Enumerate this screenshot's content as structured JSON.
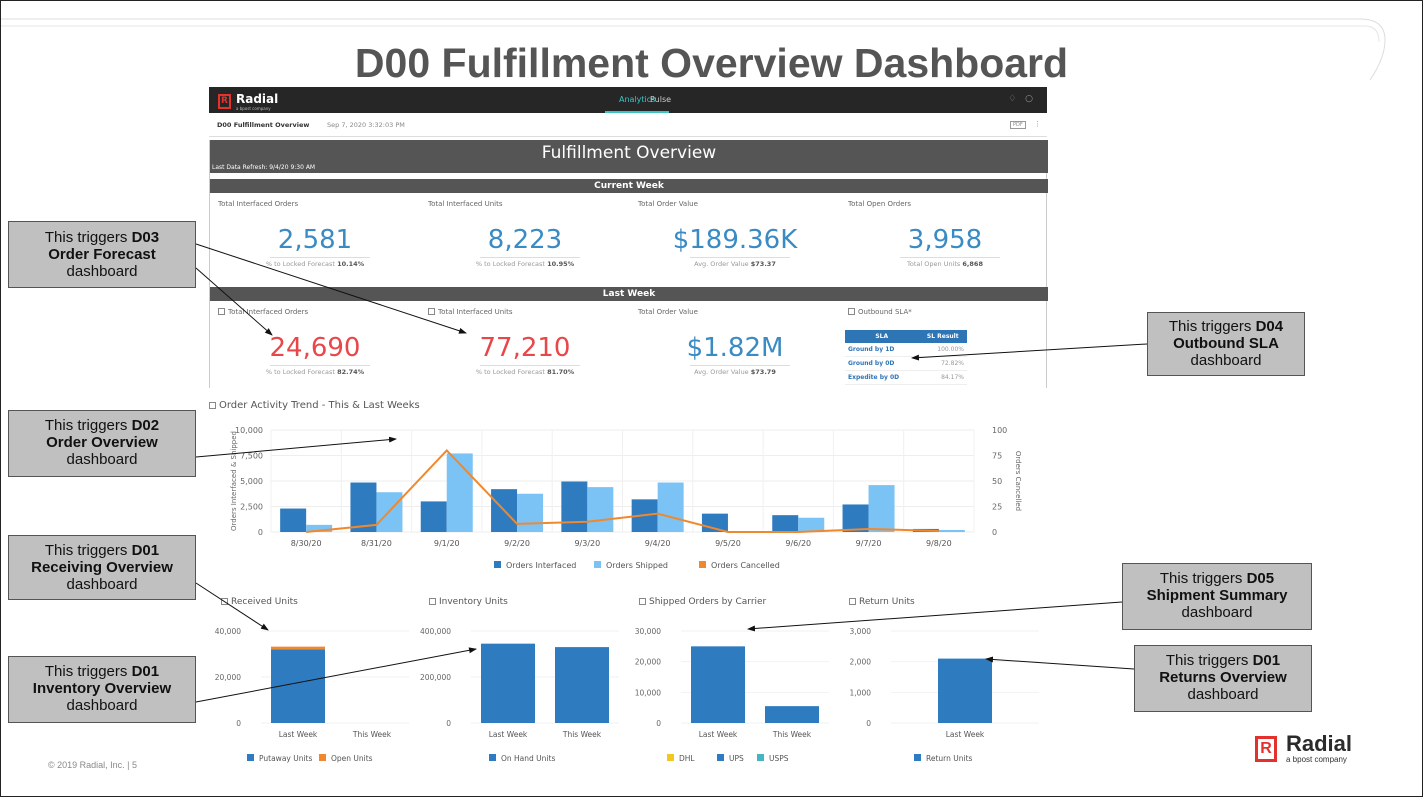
{
  "slide": {
    "title": "D00 Fulfillment Overview Dashboard",
    "footer": "© 2019 Radial, Inc.  |  5",
    "brand": {
      "name": "Radial",
      "tagline": "a bpost company"
    }
  },
  "app": {
    "logo": "Radial",
    "logo_tag": "a bpost company",
    "tabs": [
      "Analytics",
      "Pulse"
    ],
    "active_tab": "Analytics",
    "dashboard_name": "D00 Fulfillment Overview",
    "dashboard_date": "Sep 7, 2020 3:32:03 PM",
    "icons": [
      "bell-icon",
      "user-icon",
      "pdf-icon",
      "more-icon"
    ]
  },
  "overview": {
    "title": "Fulfillment Overview",
    "refresh": "Last Data Refresh: 9/4/20 9:30 AM",
    "current_week": {
      "label": "Current Week",
      "kpis": [
        {
          "label": "Total Interfaced Orders",
          "value": "2,581",
          "sub_label": "% to Locked Forecast",
          "sub_value": "10.14%"
        },
        {
          "label": "Total Interfaced Units",
          "value": "8,223",
          "sub_label": "% to Locked Forecast",
          "sub_value": "10.95%"
        },
        {
          "label": "Total Order Value",
          "value": "$189.36K",
          "sub_label": "Avg. Order Value",
          "sub_value": "$73.37"
        },
        {
          "label": "Total Open Orders",
          "value": "3,958",
          "sub_label": "Total Open Units",
          "sub_value": "6,868"
        }
      ]
    },
    "last_week": {
      "label": "Last Week",
      "kpis": [
        {
          "label": "Total Interfaced Orders",
          "value": "24,690",
          "sub_label": "% to Locked Forecast",
          "sub_value": "82.74%"
        },
        {
          "label": "Total Interfaced Units",
          "value": "77,210",
          "sub_label": "% to Locked Forecast",
          "sub_value": "81.70%"
        },
        {
          "label": "Total Order Value",
          "value": "$1.82M",
          "sub_label": "Avg. Order Value",
          "sub_value": "$73.79"
        }
      ],
      "sla": {
        "label": "Outbound SLA*",
        "headers": [
          "SLA",
          "SL Result"
        ],
        "rows": [
          [
            "Ground by 1D",
            "100.00%"
          ],
          [
            "Ground by 0D",
            "72.82%"
          ],
          [
            "Expedite by 0D",
            "84.17%"
          ]
        ]
      }
    }
  },
  "callouts": [
    {
      "pre": "This triggers ",
      "code": "D03",
      "name": "Order Forecast",
      "post": "dashboard"
    },
    {
      "pre": "This triggers ",
      "code": "D04",
      "name": "Outbound SLA",
      "post": "dashboard"
    },
    {
      "pre": "This triggers ",
      "code": "D02",
      "name": "Order Overview",
      "post": "dashboard"
    },
    {
      "pre": "This triggers ",
      "code": "D01",
      "name": "Receiving Overview",
      "post": "dashboard"
    },
    {
      "pre": "This triggers ",
      "code": "D05",
      "name": "Shipment Summary",
      "post": "dashboard"
    },
    {
      "pre": "This triggers ",
      "code": "D01",
      "name": "Inventory Overview",
      "post": "dashboard"
    },
    {
      "pre": "This triggers ",
      "code": "D01",
      "name": "Returns Overview",
      "post": "dashboard"
    }
  ],
  "colors": {
    "blue": "#2e7bbf",
    "light_blue": "#7cc3f5",
    "orange": "#f0882d",
    "yellow": "#f2c81e",
    "teal": "#46b5c3"
  },
  "chart_data": [
    {
      "type": "bar",
      "title": "Order Activity Trend - This & Last Weeks",
      "ylabel": "Orders Interfaced & Shipped",
      "y2label": "Orders Cancelled",
      "categories": [
        "8/30/20",
        "8/31/20",
        "9/1/20",
        "9/2/20",
        "9/3/20",
        "9/4/20",
        "9/5/20",
        "9/6/20",
        "9/7/20",
        "9/8/20"
      ],
      "ylim": [
        0,
        10000
      ],
      "y2lim": [
        0,
        100
      ],
      "yticks": [
        "0",
        "2,500",
        "5,000",
        "7,500",
        "10,000"
      ],
      "y2ticks": [
        "0",
        "25",
        "50",
        "75",
        "100"
      ],
      "series": [
        {
          "name": "Orders Interfaced",
          "axis": "left",
          "values": [
            2300,
            4850,
            3000,
            4200,
            4950,
            3200,
            1800,
            1650,
            2700,
            300
          ]
        },
        {
          "name": "Orders Shipped",
          "axis": "left",
          "values": [
            700,
            3900,
            7700,
            3750,
            4400,
            4850,
            0,
            1400,
            4600,
            200
          ]
        },
        {
          "name": "Orders Cancelled",
          "axis": "right",
          "type": "line",
          "values": [
            0,
            7,
            80,
            8,
            10,
            18,
            0,
            0,
            3,
            1
          ]
        }
      ],
      "grid": true,
      "legend": "bottom"
    },
    {
      "type": "bar",
      "title": "Received Units",
      "categories": [
        "Last Week",
        "This Week"
      ],
      "ylim": [
        0,
        40000
      ],
      "yticks": [
        "0",
        "20,000",
        "40,000"
      ],
      "stacked": true,
      "series": [
        {
          "name": "Putaway Units",
          "values": [
            32000,
            0
          ]
        },
        {
          "name": "Open Units",
          "values": [
            1200,
            0
          ]
        }
      ],
      "legend": "bottom"
    },
    {
      "type": "bar",
      "title": "Inventory Units",
      "categories": [
        "Last Week",
        "This Week"
      ],
      "ylim": [
        0,
        400000
      ],
      "yticks": [
        "0",
        "200,000",
        "400,000"
      ],
      "series": [
        {
          "name": "On Hand Units",
          "values": [
            345000,
            330000
          ]
        }
      ],
      "legend": "bottom"
    },
    {
      "type": "bar",
      "title": "Shipped Orders by Carrier",
      "categories": [
        "Last Week",
        "This Week"
      ],
      "ylim": [
        0,
        30000
      ],
      "yticks": [
        "0",
        "10,000",
        "20,000",
        "30,000"
      ],
      "series": [
        {
          "name": "DHL",
          "values": [
            0,
            0
          ]
        },
        {
          "name": "UPS",
          "values": [
            25000,
            5500
          ]
        },
        {
          "name": "USPS",
          "values": [
            0,
            0
          ]
        }
      ],
      "legend": "bottom"
    },
    {
      "type": "bar",
      "title": "Return Units",
      "categories": [
        "Last Week"
      ],
      "ylim": [
        0,
        3000
      ],
      "yticks": [
        "0",
        "1,000",
        "2,000",
        "3,000"
      ],
      "series": [
        {
          "name": "Return Units",
          "values": [
            2100
          ]
        }
      ],
      "legend": "bottom"
    }
  ]
}
